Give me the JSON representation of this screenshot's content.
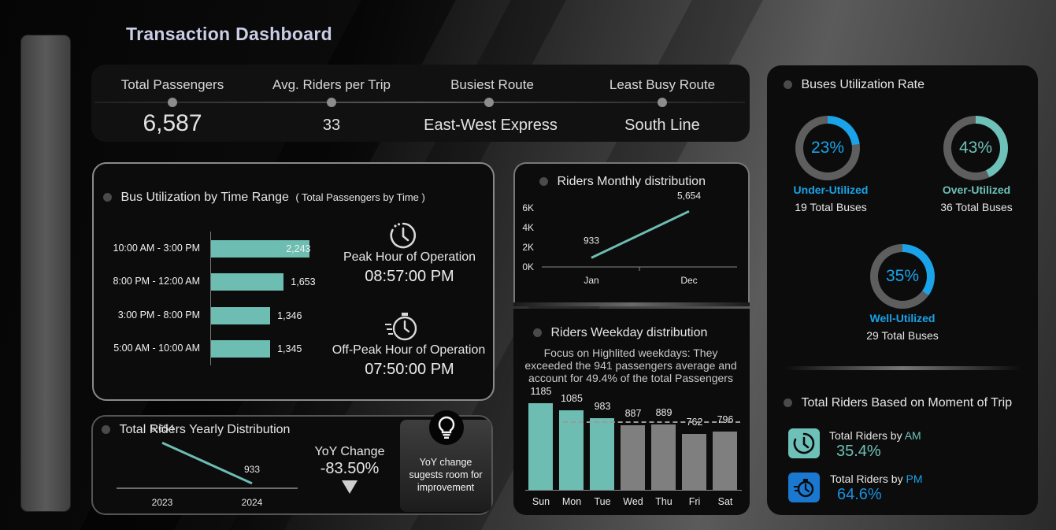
{
  "header": {
    "title": "Transaction Dashboard"
  },
  "kpis": [
    {
      "label": "Total Passengers",
      "value": "6,587"
    },
    {
      "label": "Avg. Riders per Trip",
      "value": "33"
    },
    {
      "label": "Busiest Route",
      "value": "East-West Express"
    },
    {
      "label": "Least Busy Route",
      "value": "South Line"
    }
  ],
  "time_range": {
    "title": "Bus Utilization by Time Range",
    "subtitle": "( Total Passengers by Time )",
    "peak_label": "Peak Hour of Operation",
    "peak_value": "08:57:00 PM",
    "offpeak_label": "Off-Peak Hour of Operation",
    "offpeak_value": "07:50:00 PM",
    "icons": {
      "peak": "clock-icon",
      "offpeak": "stopwatch-icon"
    }
  },
  "monthly": {
    "title": "Riders Monthly distribution"
  },
  "weekday": {
    "title": "Riders Weekday distribution",
    "note": "Focus on Highlited weekdays: They exceeded the 941 passengers average and account for 49.4% of the total Passengers"
  },
  "yearly": {
    "title": "Total Riders Yearly Distribution",
    "yoy_label": "YoY Change",
    "yoy_value": "-83.50%",
    "insight": "YoY change sugests room for improvement",
    "icons": {
      "insight": "lightbulb-icon",
      "trend": "triangle-down-icon"
    }
  },
  "utilization": {
    "title": "Buses Utilization Rate",
    "items": [
      {
        "pct": "23%",
        "label": "Under-Utilized",
        "count": "19 Total Buses",
        "fraction": 0.23,
        "color": "#1aa3e8"
      },
      {
        "pct": "43%",
        "label": "Over-Utilized",
        "count": "36 Total Buses",
        "fraction": 0.43,
        "color": "#6dc1b8"
      },
      {
        "pct": "35%",
        "label": "Well-Utilized",
        "count": "29 Total Buses",
        "fraction": 0.35,
        "color": "#1aa3e8"
      }
    ]
  },
  "moment": {
    "title": "Total Riders Based on Moment of Trip",
    "am_prefix": "Total Riders by ",
    "am_tag": "AM",
    "am_value": "35.4%",
    "pm_prefix": "Total Riders by ",
    "pm_tag": "PM",
    "pm_value": "64.6%",
    "icons": {
      "am": "clock-icon",
      "pm": "stopwatch-icon"
    }
  },
  "colors": {
    "teal": "#6dbdb3",
    "blue": "#1aa3e8",
    "gray": "#7f7f7f"
  },
  "chart_data": [
    {
      "type": "bar",
      "orientation": "horizontal",
      "categories": [
        "10:00 AM - 3:00 PM",
        "8:00 PM - 12:00 AM",
        "3:00 PM - 8:00 PM",
        "5:00 AM - 10:00 AM"
      ],
      "values": [
        2243,
        1653,
        1346,
        1345
      ],
      "value_labels": [
        "2,243",
        "1,653",
        "1,346",
        "1,345"
      ],
      "xlim": [
        0,
        2400
      ]
    },
    {
      "type": "line",
      "categories": [
        "Jan",
        "Dec"
      ],
      "values": [
        933,
        5654
      ],
      "value_labels": [
        "933",
        "5,654"
      ],
      "yticks": [
        "0K",
        "2K",
        "4K",
        "6K"
      ],
      "ylim": [
        0,
        6000
      ]
    },
    {
      "type": "bar",
      "categories": [
        "Sun",
        "Mon",
        "Tue",
        "Wed",
        "Thu",
        "Fri",
        "Sat"
      ],
      "values": [
        1185,
        1085,
        983,
        887,
        889,
        762,
        796
      ],
      "highlighted": [
        true,
        true,
        true,
        false,
        false,
        false,
        false
      ],
      "average": 941,
      "ylim": [
        0,
        1400
      ]
    },
    {
      "type": "line",
      "categories": [
        "2023",
        "2024"
      ],
      "values": [
        5654,
        933
      ],
      "value_labels": [
        "5,654",
        "933"
      ],
      "ylim": [
        0,
        6500
      ]
    }
  ]
}
